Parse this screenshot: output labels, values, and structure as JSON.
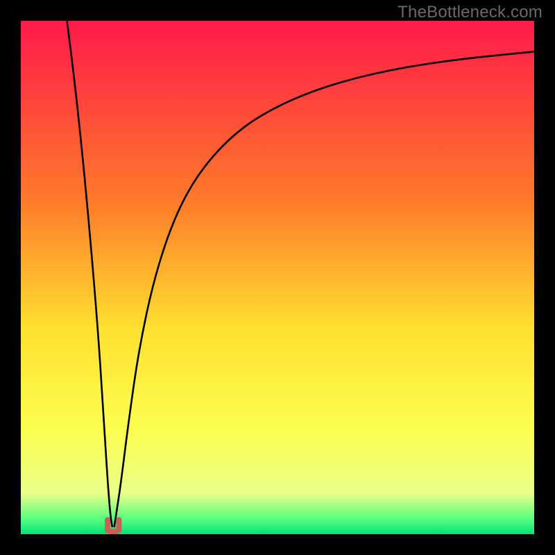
{
  "watermark": "TheBottleneck.com",
  "chart_data": {
    "type": "line",
    "title": "",
    "xlabel": "",
    "ylabel": "",
    "xlim": [
      0,
      100
    ],
    "ylim": [
      0,
      100
    ],
    "x_optimum": 18,
    "sweet_spot_width": 2.2,
    "sweet_spot_color": "#c86058",
    "green_band_top": 96,
    "gradient_stops": [
      {
        "offset": 0,
        "color": "#ff1a4a"
      },
      {
        "offset": 35,
        "color": "#ff7a2a"
      },
      {
        "offset": 60,
        "color": "#ffe030"
      },
      {
        "offset": 80,
        "color": "#fbff50"
      },
      {
        "offset": 92,
        "color": "#eaff8a"
      },
      {
        "offset": 97,
        "color": "#58ff80"
      },
      {
        "offset": 100,
        "color": "#00e278"
      }
    ],
    "series": [
      {
        "name": "left-branch",
        "x": [
          9.0,
          10.5,
          12.0,
          13.5,
          15.0,
          16.0,
          16.8,
          17.4,
          17.8
        ],
        "values": [
          100,
          88,
          74,
          58,
          40,
          25,
          12,
          4,
          1.5
        ]
      },
      {
        "name": "right-branch",
        "x": [
          18.2,
          18.6,
          19.5,
          21.0,
          23.0,
          26.0,
          30.0,
          35.0,
          42.0,
          50.0,
          60.0,
          72.0,
          85.0,
          100.0
        ],
        "values": [
          1.5,
          4,
          10,
          22,
          36,
          50,
          62,
          71,
          78.5,
          83.5,
          87.5,
          90.5,
          92.5,
          94.0
        ]
      }
    ]
  }
}
